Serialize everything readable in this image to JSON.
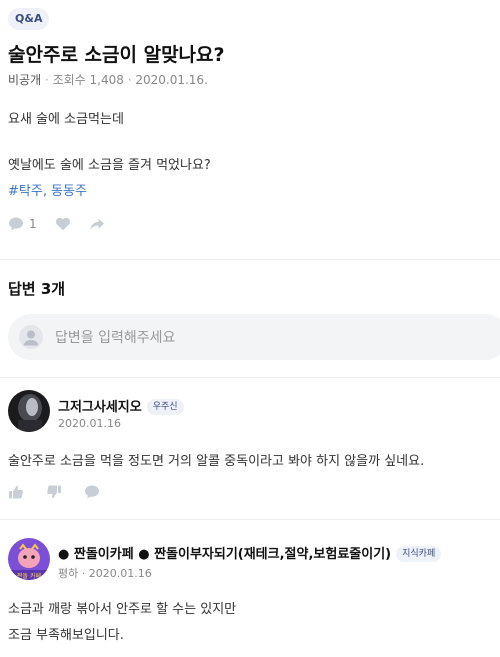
{
  "question": {
    "category": "Q&A",
    "title": "술안주로 소금이 알맞나요?",
    "visibility": "비공개",
    "views": "조회수 1,408",
    "date": "2020.01.16.",
    "body_line1": "요새 술에 소금먹는데",
    "body_line2": "옛날에도 술에 소금을 즐겨 먹었나요?",
    "tags": "#탁주, 동동주",
    "comment_count": "1"
  },
  "answers": {
    "header": "답변 3개",
    "input_placeholder": "답변을 입력해주세요",
    "items": [
      {
        "name": "그저그사세지오",
        "badge": "우주신",
        "date": "2020.01.16",
        "text_line1": "술안주로 소금을 먹을 정도면 거의 알콜 중독이라고 봐야 하지 않을까 싶네요."
      },
      {
        "name": "● 짠돌이카페 ● 짠돌이부자되기(재테크,절약,보험료줄이기)",
        "badge": "지식카페",
        "rank": "평하",
        "date": "2020.01.16",
        "text_line1": "소금과 깨랑 볶아서 안주로 할 수는 있지만",
        "text_line2": "조금 부족해보입니다.",
        "avatar_caption": "짠돌 카페"
      }
    ]
  },
  "colors": {
    "accent": "#3a77c7",
    "badge_bg": "#eef1f7",
    "icon": "#c9ced6"
  },
  "icons": [
    "comment-icon",
    "heart-icon",
    "share-icon",
    "user-placeholder-icon",
    "thumbs-up-icon",
    "thumbs-down-icon",
    "reply-icon"
  ]
}
